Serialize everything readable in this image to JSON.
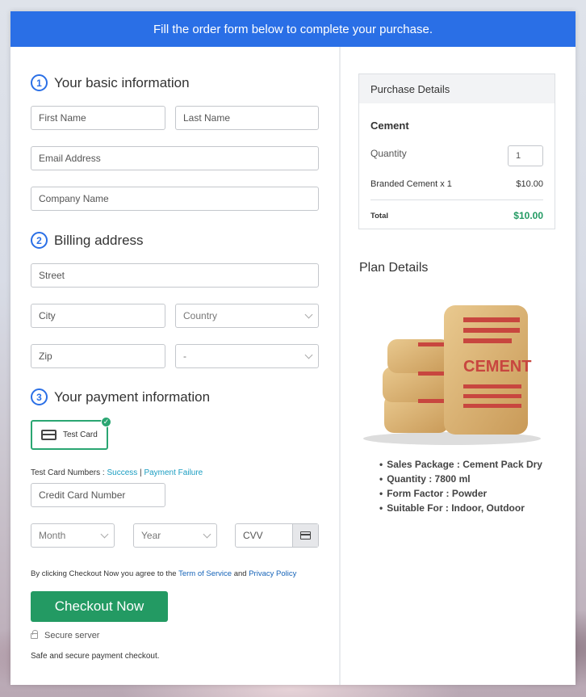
{
  "header": {
    "text": "Fill the order form below to complete your purchase."
  },
  "basic": {
    "step": "1",
    "title": "Your basic information",
    "first_name": "First Name",
    "last_name": "Last Name",
    "email": "Email Address",
    "company": "Company Name"
  },
  "billing": {
    "step": "2",
    "title": "Billing address",
    "street": "Street",
    "city": "City",
    "country": "Country",
    "zip": "Zip",
    "state": "-"
  },
  "payment": {
    "step": "3",
    "title": "Your payment information",
    "test_card_label": "Test Card",
    "test_numbers_prefix": "Test Card Numbers : ",
    "success": "Success",
    "separator": " | ",
    "failure": "Payment Failure",
    "card_number": "Credit Card Number",
    "month": "Month",
    "year": "Year",
    "cvv": "CVV"
  },
  "terms": {
    "prefix": "By clicking Checkout Now you agree to the ",
    "tos": "Term of Service",
    "and": " and ",
    "privacy": "Privacy Policy"
  },
  "checkout": {
    "label": "Checkout Now",
    "secure": "Secure server",
    "note": "Safe and secure payment checkout."
  },
  "purchase": {
    "title": "Purchase Details",
    "product": "Cement",
    "quantity_label": "Quantity",
    "quantity_value": "1",
    "line_item": "Branded Cement x 1",
    "line_price": "$10.00",
    "total_label": "Total",
    "total_value": "$10.00"
  },
  "plan": {
    "title": "Plan Details",
    "image_text": "CEMENT",
    "features": [
      "Sales Package : Cement Pack Dry",
      "Quantity : 7800 ml",
      "Form Factor : Powder",
      "Suitable For : Indoor, Outdoor"
    ]
  },
  "colors": {
    "brand": "#2a6fe6",
    "success": "#239a63",
    "link": "#1a9dc1"
  }
}
